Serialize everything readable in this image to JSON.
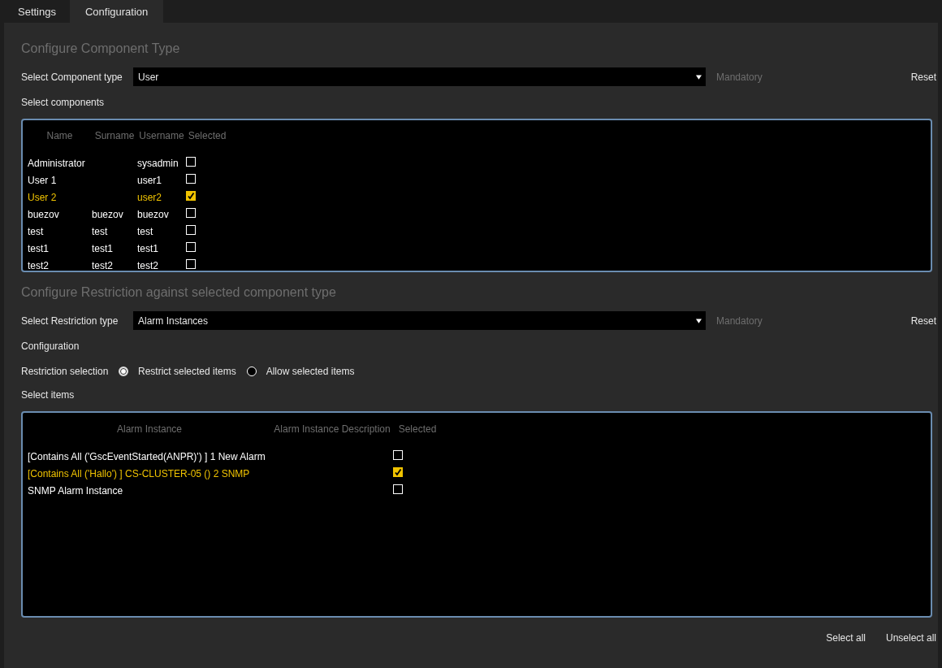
{
  "tabs": [
    {
      "label": "Settings",
      "selected": false
    },
    {
      "label": "Configuration",
      "selected": true
    }
  ],
  "component_section": {
    "title": "Configure Component Type",
    "type_label": "Select Component type",
    "type_value": "User",
    "mandatory": "Mandatory",
    "reset": "Reset",
    "list_label": "Select components"
  },
  "components": {
    "columns": [
      "Name",
      "Surname",
      "Username",
      "Selected"
    ],
    "rows": [
      {
        "name": "Administrator",
        "surname": "",
        "username": "sysadmin",
        "selected": false
      },
      {
        "name": "User 1",
        "surname": "",
        "username": "user1",
        "selected": false
      },
      {
        "name": "User 2",
        "surname": "",
        "username": "user2",
        "selected": true
      },
      {
        "name": "buezov",
        "surname": "buezov",
        "username": "buezov",
        "selected": false
      },
      {
        "name": "test",
        "surname": "test",
        "username": "test",
        "selected": false
      },
      {
        "name": "test1",
        "surname": "test1",
        "username": "test1",
        "selected": false
      },
      {
        "name": "test2",
        "surname": "test2",
        "username": "test2",
        "selected": false
      }
    ]
  },
  "restriction_section": {
    "title": "Configure Restriction against selected component type",
    "type_label": "Select Restriction type",
    "type_value": "Alarm Instances",
    "mandatory": "Mandatory",
    "reset": "Reset",
    "config_label": "Configuration",
    "selection_label": "Restriction selection",
    "options": [
      {
        "label": "Restrict selected items",
        "selected": true
      },
      {
        "label": "Allow selected items",
        "selected": false
      }
    ],
    "list_label": "Select items"
  },
  "items": {
    "columns": [
      "Alarm Instance",
      "Alarm Instance Description",
      "Selected"
    ],
    "rows": [
      {
        "instance": "[Contains All ('GscEventStarted(ANPR)') ] 1 New Alarm",
        "selected": false
      },
      {
        "instance": "[Contains All ('Hallo') ] CS-CLUSTER-05 () 2 SNMP",
        "selected": true
      },
      {
        "instance": "SNMP Alarm Instance",
        "selected": false
      }
    ]
  },
  "footer_buttons": [
    "Select all",
    "Unselect all"
  ]
}
